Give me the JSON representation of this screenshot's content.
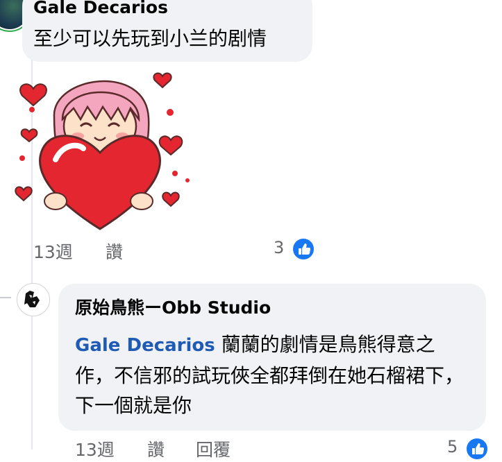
{
  "comment1": {
    "author": "Gale Decarios",
    "text": "至少可以先玩到小兰的剧情",
    "sticker": "heart-hug-sticker",
    "time": "13週",
    "like_label": "讚",
    "reaction_count": "3",
    "reaction_icon": "thumbs-up-icon"
  },
  "reply1": {
    "author": "原始鳥熊ーObb Studio",
    "mention": "Gale Decarios",
    "text": "蘭蘭的劇情是鳥熊得意之作，不信邪的試玩俠全都拜倒在她石榴裙下，下一個就是你",
    "time": "13週",
    "like_label": "讚",
    "reply_label": "回覆",
    "reaction_count": "5",
    "reaction_icon": "thumbs-up-icon"
  },
  "colors": {
    "bubble": "#f0f2f5",
    "mention": "#1f5bb5",
    "meta": "#65676b",
    "like_blue": "#1877f2"
  }
}
